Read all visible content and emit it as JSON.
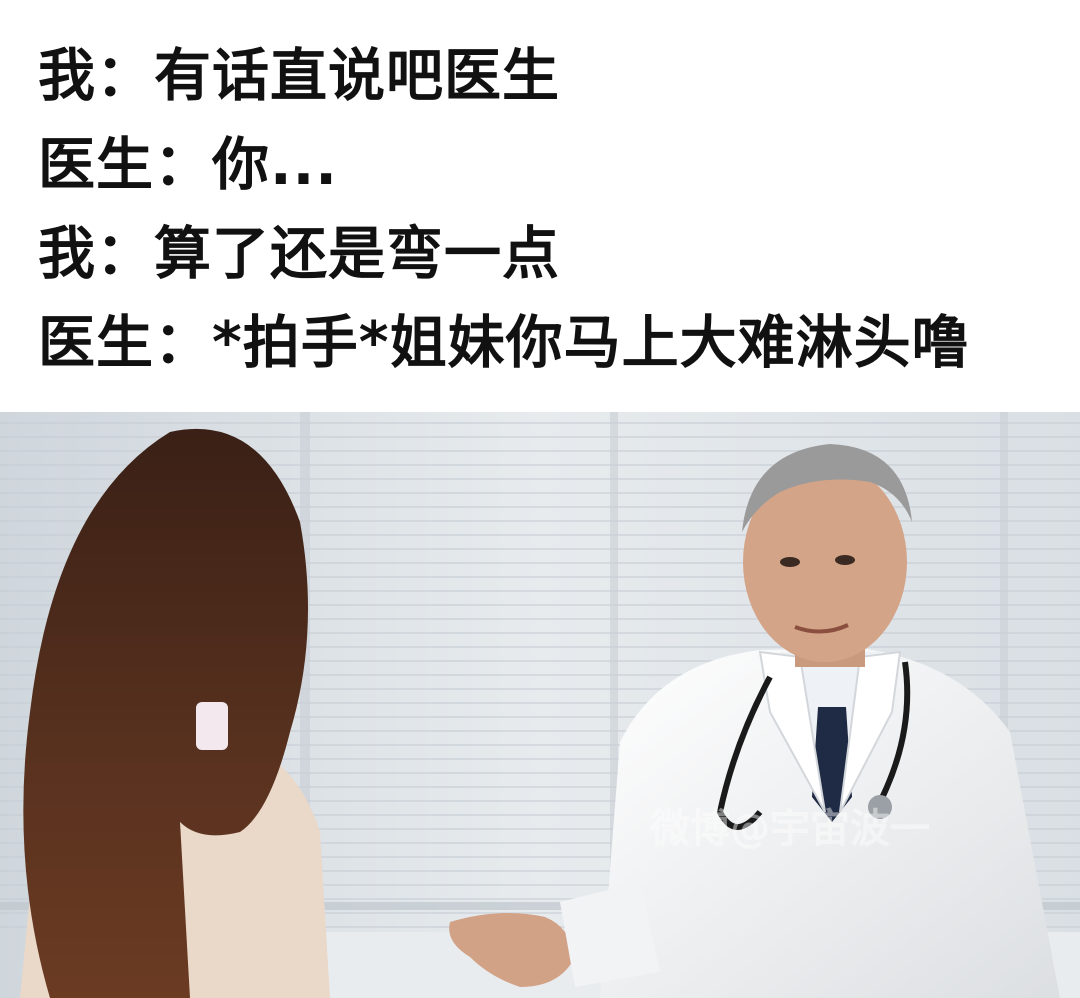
{
  "caption": {
    "lines": [
      "我：有话直说吧医生",
      "医生：你...",
      "我：算了还是弯一点",
      "医生：*拍手*姐妹你马上大难淋头噜"
    ]
  },
  "photo": {
    "subject": "doctor talking to a long-haired woman patient in a bright office",
    "watermark_text": "微博@宇宙波一"
  },
  "colors": {
    "caption_bg": "#ffffff",
    "caption_text": "#111111",
    "hair": "#4a2a1c",
    "coat": "#f4f4f2",
    "blinds": "#dfe4e8",
    "tie": "#1f2a44"
  }
}
